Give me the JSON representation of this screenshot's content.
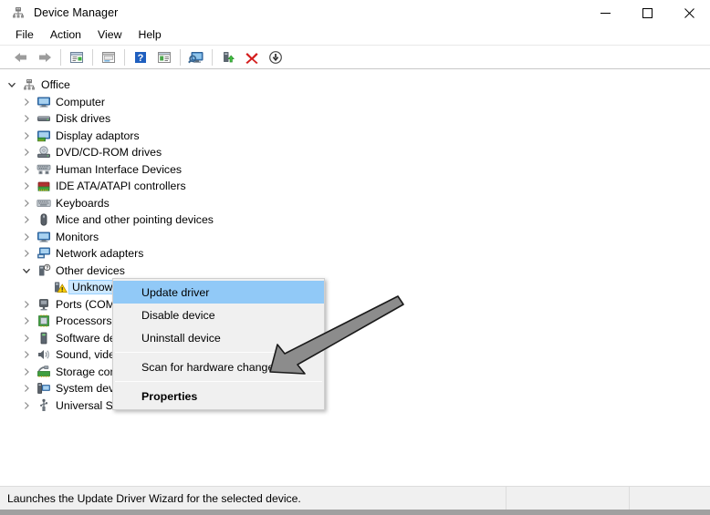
{
  "window": {
    "title": "Device Manager",
    "app_icon": "device-manager-icon",
    "controls": {
      "minimize": "minimize-icon",
      "maximize": "maximize-icon",
      "close": "close-icon"
    }
  },
  "menubar": {
    "items": [
      {
        "label": "File"
      },
      {
        "label": "Action"
      },
      {
        "label": "View"
      },
      {
        "label": "Help"
      }
    ]
  },
  "toolbar": {
    "buttons": [
      {
        "name": "back-icon"
      },
      {
        "name": "forward-icon"
      },
      {
        "name": "properties-icon"
      },
      {
        "name": "show-hide-console-tree-icon"
      },
      {
        "name": "help-icon"
      },
      {
        "name": "view-icon"
      },
      {
        "name": "scan-for-hardware-changes-icon"
      },
      {
        "name": "enable-device-icon"
      },
      {
        "name": "uninstall-device-icon"
      },
      {
        "name": "update-driver-icon"
      }
    ]
  },
  "tree": {
    "nodes": [
      {
        "label": "Office",
        "depth": 0,
        "expanded": true,
        "icon": "computer-root-icon",
        "selected": false
      },
      {
        "label": "Computer",
        "depth": 1,
        "expanded": false,
        "icon": "computer-icon",
        "selected": false
      },
      {
        "label": "Disk drives",
        "depth": 1,
        "expanded": false,
        "icon": "disk-drive-icon",
        "selected": false
      },
      {
        "label": "Display adaptors",
        "depth": 1,
        "expanded": false,
        "icon": "display-adapter-icon",
        "selected": false
      },
      {
        "label": "DVD/CD-ROM drives",
        "depth": 1,
        "expanded": false,
        "icon": "dvd-drive-icon",
        "selected": false
      },
      {
        "label": "Human Interface Devices",
        "depth": 1,
        "expanded": false,
        "icon": "hid-icon",
        "selected": false
      },
      {
        "label": "IDE ATA/ATAPI controllers",
        "depth": 1,
        "expanded": false,
        "icon": "ide-controller-icon",
        "selected": false
      },
      {
        "label": "Keyboards",
        "depth": 1,
        "expanded": false,
        "icon": "keyboard-icon",
        "selected": false
      },
      {
        "label": "Mice and other pointing devices",
        "depth": 1,
        "expanded": false,
        "icon": "mouse-icon",
        "selected": false
      },
      {
        "label": "Monitors",
        "depth": 1,
        "expanded": false,
        "icon": "monitor-icon",
        "selected": false
      },
      {
        "label": "Network adapters",
        "depth": 1,
        "expanded": false,
        "icon": "network-adapter-icon",
        "selected": false
      },
      {
        "label": "Other devices",
        "depth": 1,
        "expanded": true,
        "icon": "other-devices-icon",
        "selected": false
      },
      {
        "label": "Unknown device",
        "depth": 2,
        "expanded": null,
        "icon": "unknown-device-warning-icon",
        "selected": true
      },
      {
        "label": "Ports (COM & LPT)",
        "depth": 1,
        "expanded": false,
        "icon": "port-icon",
        "selected": false
      },
      {
        "label": "Processors",
        "depth": 1,
        "expanded": false,
        "icon": "processor-icon",
        "selected": false
      },
      {
        "label": "Software devices",
        "depth": 1,
        "expanded": false,
        "icon": "software-device-icon",
        "selected": false
      },
      {
        "label": "Sound, video and game controllers",
        "depth": 1,
        "expanded": false,
        "icon": "sound-icon",
        "selected": false
      },
      {
        "label": "Storage controllers",
        "depth": 1,
        "expanded": false,
        "icon": "storage-controller-icon",
        "selected": false
      },
      {
        "label": "System devices",
        "depth": 1,
        "expanded": false,
        "icon": "system-device-icon",
        "selected": false
      },
      {
        "label": "Universal Serial Bus controllers",
        "depth": 1,
        "expanded": false,
        "icon": "usb-controller-icon",
        "selected": false
      }
    ]
  },
  "context_menu": {
    "items": [
      {
        "label": "Update driver",
        "type": "item",
        "highlighted": true,
        "bold": false
      },
      {
        "label": "Disable device",
        "type": "item",
        "highlighted": false,
        "bold": false
      },
      {
        "label": "Uninstall device",
        "type": "item",
        "highlighted": false,
        "bold": false
      },
      {
        "label": "",
        "type": "separator"
      },
      {
        "label": "Scan for hardware changes",
        "type": "item",
        "highlighted": false,
        "bold": false
      },
      {
        "label": "",
        "type": "separator"
      },
      {
        "label": "Properties",
        "type": "item",
        "highlighted": false,
        "bold": true
      }
    ]
  },
  "annotation": {
    "arrow": "pointer-arrow-icon"
  },
  "statusbar": {
    "message": "Launches the Update Driver Wizard for the selected device.",
    "pane2": "",
    "pane3": ""
  },
  "colors": {
    "selection_blue": "#cce8ff",
    "menu_highlight_blue": "#91c9f7",
    "menu_background": "#f0f0f0",
    "statusbar_background": "#f0f0f0",
    "warning_yellow": "#ffd200",
    "uninstall_red": "#d41c1c",
    "arrow_gray": "#8c8c8c"
  }
}
